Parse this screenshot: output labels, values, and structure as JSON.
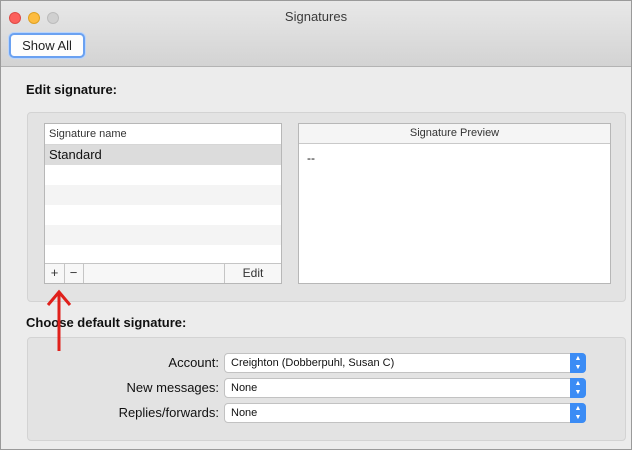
{
  "window": {
    "title": "Signatures",
    "show_all_label": "Show All"
  },
  "edit_section": {
    "title": "Edit signature:",
    "list_header": "Signature name",
    "signatures": [
      "Standard"
    ],
    "add_label": "+",
    "remove_label": "−",
    "edit_label": "Edit",
    "preview_header": "Signature Preview",
    "preview_text": "--"
  },
  "default_section": {
    "title": "Choose default signature:",
    "account_label": "Account:",
    "account_value": "Creighton (Dobberpuhl, Susan C)",
    "new_messages_label": "New messages:",
    "new_messages_value": "None",
    "replies_label": "Replies/forwards:",
    "replies_value": "None"
  },
  "colors": {
    "accent": "#3b8cf5",
    "annotation": "#e0201b"
  }
}
